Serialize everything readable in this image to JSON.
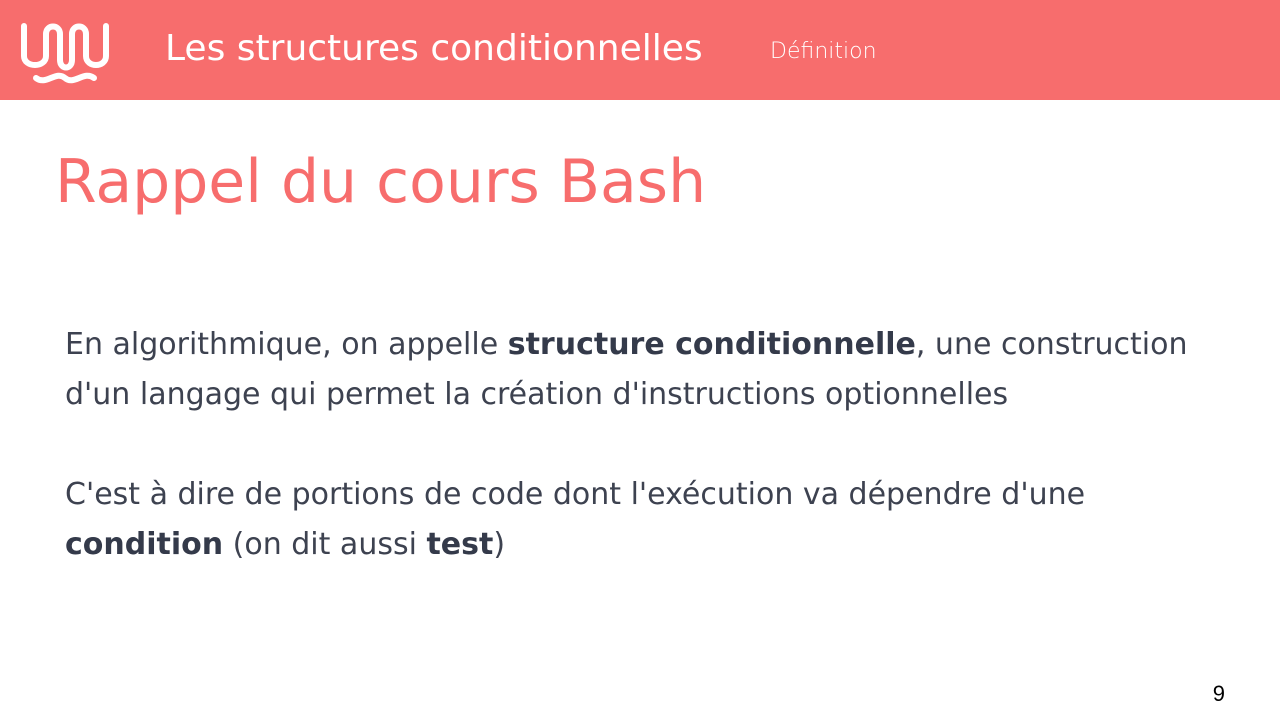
{
  "header": {
    "logo_icon": "wavy-loop-logo-icon",
    "title": "Les structures conditionnelles",
    "section": "Définition",
    "background_color": "#f76d6d"
  },
  "main": {
    "title": "Rappel du cours Bash",
    "title_color": "#f76d6d",
    "paragraph1": {
      "before": "En algorithmique, on appelle ",
      "bold": "structure conditionnelle",
      "after": ", une construction d'un langage qui permet la création d'instructions optionnelles"
    },
    "paragraph2": {
      "before": "C'est à dire de portions de code dont l'exécution va dépendre d'une ",
      "bold1": "condition",
      "middle": " (on dit aussi ",
      "bold2": "test",
      "after": ")"
    },
    "text_color": "#3d4250"
  },
  "footer": {
    "page_number": "9"
  }
}
